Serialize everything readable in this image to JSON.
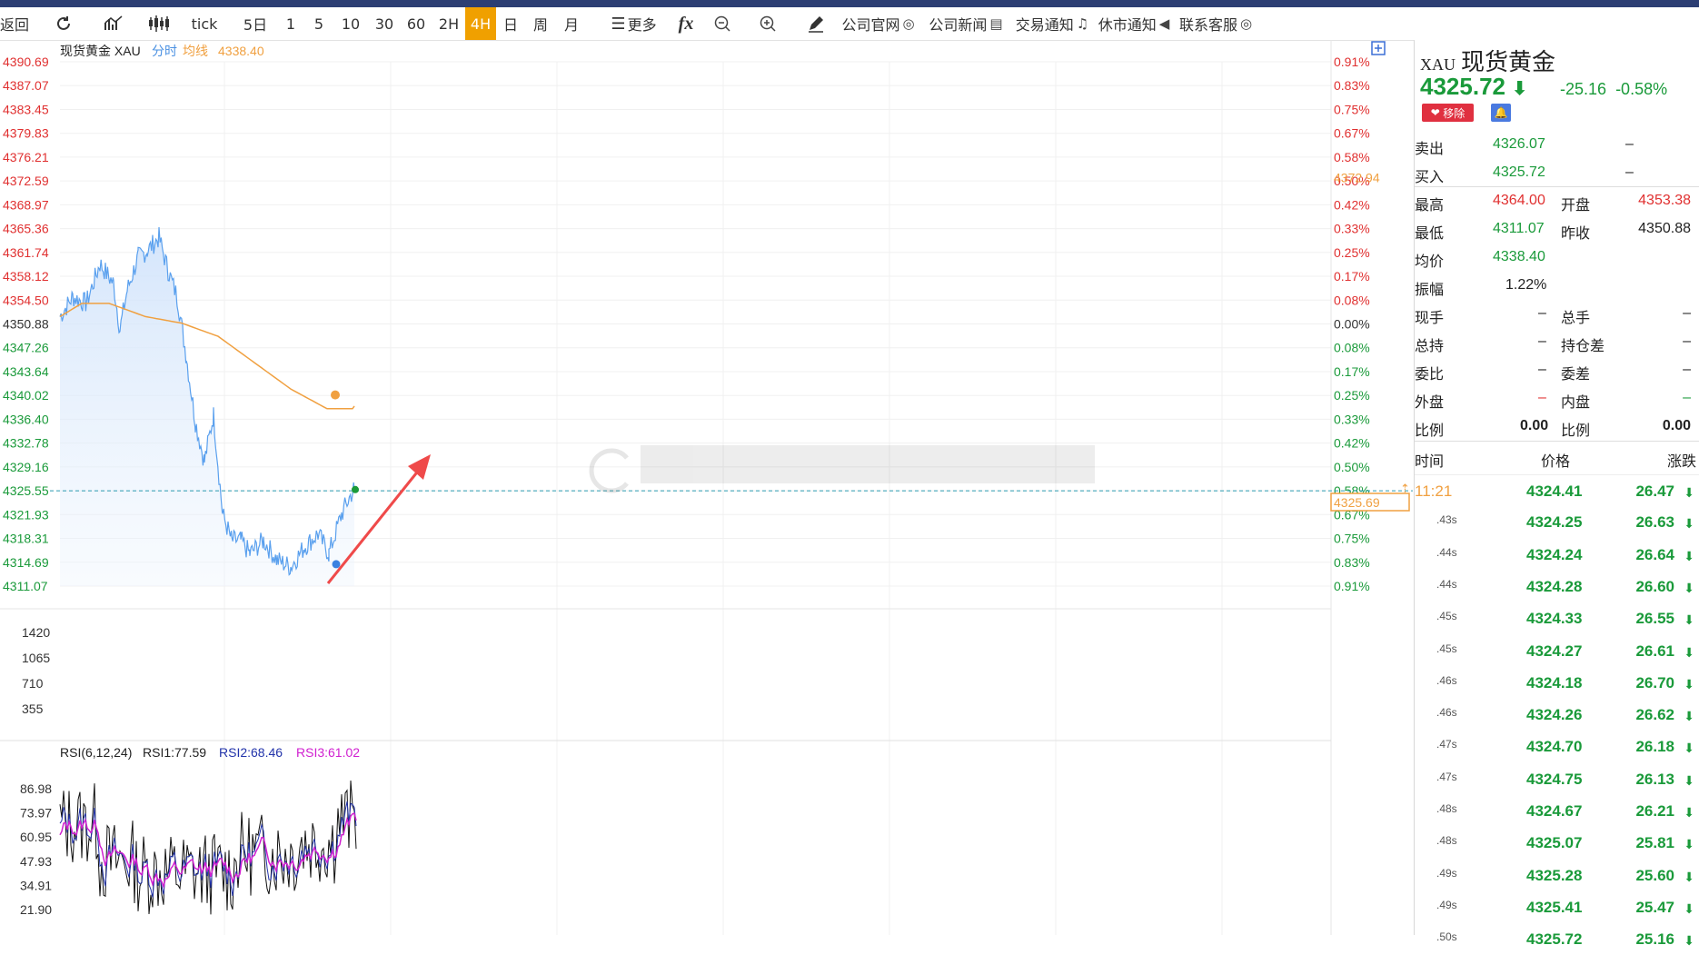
{
  "toolbar": {
    "back": "返回",
    "tick": "tick",
    "periods": [
      "5日",
      "1",
      "5",
      "10",
      "30",
      "60",
      "2H",
      "4H",
      "日",
      "周",
      "月"
    ],
    "active_period": "4H",
    "more": "更多",
    "fx": "fx",
    "links": [
      "公司官网",
      "公司新闻",
      "交易通知",
      "休市通知",
      "联系客服"
    ]
  },
  "main_chart": {
    "title": "现货黄金 XAU",
    "tab_fenshi": "分时",
    "avg_label": "均线",
    "avg_value": "4338.40",
    "price_ticks": [
      "4390.69",
      "4387.07",
      "4383.45",
      "4379.83",
      "4376.21",
      "4372.59",
      "4368.97",
      "4365.36",
      "4361.74",
      "4358.12",
      "4354.50",
      "4350.88",
      "4347.26",
      "4343.64",
      "4340.02",
      "4336.40",
      "4332.78",
      "4329.16",
      "4325.55",
      "4321.93",
      "4318.31",
      "4314.69",
      "4311.07"
    ],
    "pct_ticks": [
      "0.91%",
      "0.83%",
      "0.75%",
      "0.67%",
      "0.58%",
      "0.50%",
      "0.42%",
      "0.33%",
      "0.25%",
      "0.17%",
      "0.08%",
      "0.00%",
      "0.08%",
      "0.17%",
      "0.25%",
      "0.33%",
      "0.42%",
      "0.50%",
      "0.58%",
      "0.67%",
      "0.75%",
      "0.83%",
      "0.91%"
    ],
    "ref_price": "4350.88",
    "high_marker": "4372.94",
    "current_marker": "4325.69"
  },
  "volume_panel": {
    "ticks": [
      "1420",
      "1065",
      "710",
      "355"
    ]
  },
  "rsi_panel": {
    "title": "RSI(6,12,24)",
    "rsi1": "RSI1:77.59",
    "rsi2": "RSI2:68.46",
    "rsi3": "RSI3:61.02",
    "ticks": [
      "86.98",
      "73.97",
      "60.95",
      "47.93",
      "34.91",
      "21.90"
    ]
  },
  "quote": {
    "symbol": "XAU",
    "name": "现货黄金",
    "price": "4325.72",
    "change": "-25.16",
    "change_pct": "-0.58%",
    "remove_btn": "移除",
    "sell_label": "卖出",
    "sell": "4326.07",
    "sell_vol": "–",
    "buy_label": "买入",
    "buy": "4325.72",
    "buy_vol": "–",
    "high_label": "最高",
    "high": "4364.00",
    "open_label": "开盘",
    "open": "4353.38",
    "low_label": "最低",
    "low": "4311.07",
    "prev_label": "昨收",
    "prev": "4350.88",
    "avg_label": "均价",
    "avg": "4338.40",
    "amp_label": "振幅",
    "amp": "1.22%",
    "xianshou_label": "现手",
    "xianshou": "–",
    "zongshou_label": "总手",
    "zongshou": "–",
    "zongchi_label": "总持",
    "zongchi": "–",
    "chicangcha_label": "持仓差",
    "chicangcha": "–",
    "weibi_label": "委比",
    "weibi": "–",
    "weicha_label": "委差",
    "weicha": "–",
    "waipan_label": "外盘",
    "waipan": "–",
    "neipan_label": "内盘",
    "neipan": "–",
    "bili_label": "比例",
    "bili": "0.00",
    "bili2_label": "比例",
    "bili2": "0.00",
    "th_time": "时间",
    "th_price": "价格",
    "th_change": "涨跌"
  },
  "trades": [
    {
      "t": "11:21",
      "p": "4324.41",
      "c": "26.47"
    },
    {
      "t": ".43s",
      "p": "4324.25",
      "c": "26.63"
    },
    {
      "t": ".44s",
      "p": "4324.24",
      "c": "26.64"
    },
    {
      "t": ".44s",
      "p": "4324.28",
      "c": "26.60"
    },
    {
      "t": ".45s",
      "p": "4324.33",
      "c": "26.55"
    },
    {
      "t": ".45s",
      "p": "4324.27",
      "c": "26.61"
    },
    {
      "t": ".46s",
      "p": "4324.18",
      "c": "26.70"
    },
    {
      "t": ".46s",
      "p": "4324.26",
      "c": "26.62"
    },
    {
      "t": ".47s",
      "p": "4324.70",
      "c": "26.18"
    },
    {
      "t": ".47s",
      "p": "4324.75",
      "c": "26.13"
    },
    {
      "t": ".48s",
      "p": "4324.67",
      "c": "26.21"
    },
    {
      "t": ".48s",
      "p": "4325.07",
      "c": "25.81"
    },
    {
      "t": ".49s",
      "p": "4325.28",
      "c": "25.60"
    },
    {
      "t": ".49s",
      "p": "4325.41",
      "c": "25.47"
    },
    {
      "t": ".50s",
      "p": "4325.72",
      "c": "25.16"
    }
  ],
  "colors": {
    "up": "#e03030",
    "down": "#1a9a3a",
    "price_line": "#4a90e2",
    "avg_line": "#f0a040",
    "accent": "#f0a000"
  }
}
